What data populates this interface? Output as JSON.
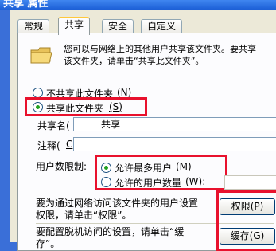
{
  "window": {
    "title": "共享 属性"
  },
  "tabs": [
    {
      "label": "常规"
    },
    {
      "label": "共享"
    },
    {
      "label": "安全"
    },
    {
      "label": "自定义"
    }
  ],
  "share": {
    "intro": "您可以与网络上的其他用户共享该文件夹。要共享\n该文件夹，请单击“共享此文件夹”。",
    "no_share_label": "不共享此文件夹",
    "no_share_key": "(N)",
    "share_label": "共享此文件夹",
    "share_key": "(S)",
    "share_name_label": "共享名(",
    "share_name_value": "共享",
    "comment_label": "注释(",
    "comment_key": "C",
    "user_limit_label": "用户数限制:",
    "max_users_label": "允许最多用户",
    "max_users_key": "(M)",
    "allowed_users_label": "允许的用户数量",
    "allowed_users_key": "(W):",
    "permissions_text": "要为通过网络访问该文件夹的用户设置\n权限，请单击“权限”。",
    "permissions_button": "权限(P)",
    "caching_text": "要配置脱机访问的设置，请单击“缓\n存”。",
    "caching_button": "缓存(G)"
  },
  "colors": {
    "highlight_box": "#e8112d",
    "active_tab_accent": "#ffc83c"
  },
  "icons": {
    "folder": "shared-folder-icon"
  }
}
